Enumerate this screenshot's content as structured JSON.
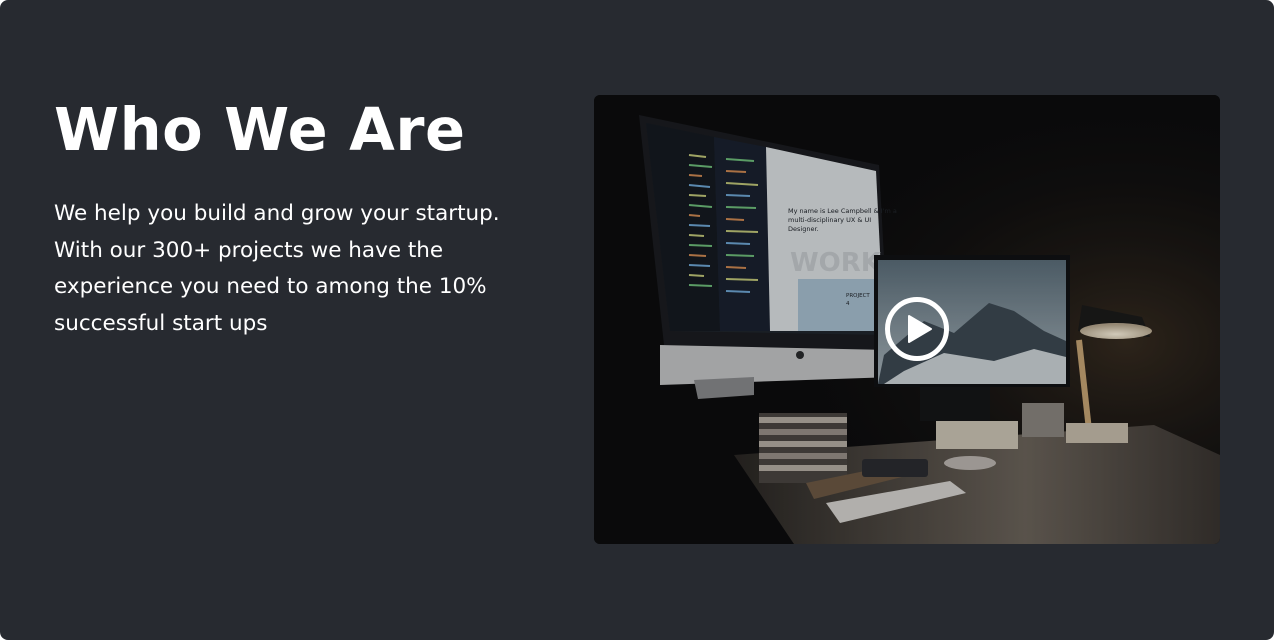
{
  "section": {
    "title": "Who We Are",
    "description_lines": [
      "We help you build and grow your startup.",
      "With our 300+ projects we have the",
      "experience you need to among the 10%",
      "successful start ups"
    ]
  },
  "video": {
    "play_icon": "play-circle-icon",
    "screen_text": {
      "intro_line1": "My name is Lee Campbell & I'm a",
      "intro_line2": "multi-disciplinary UX & UI",
      "intro_line3": "Designer.",
      "watermark": "WORK",
      "project_label": "PROJECT",
      "project_number": "4"
    }
  },
  "colors": {
    "background": "#272a30",
    "text": "#ffffff",
    "accent_cyan": "#2bb7b0"
  }
}
